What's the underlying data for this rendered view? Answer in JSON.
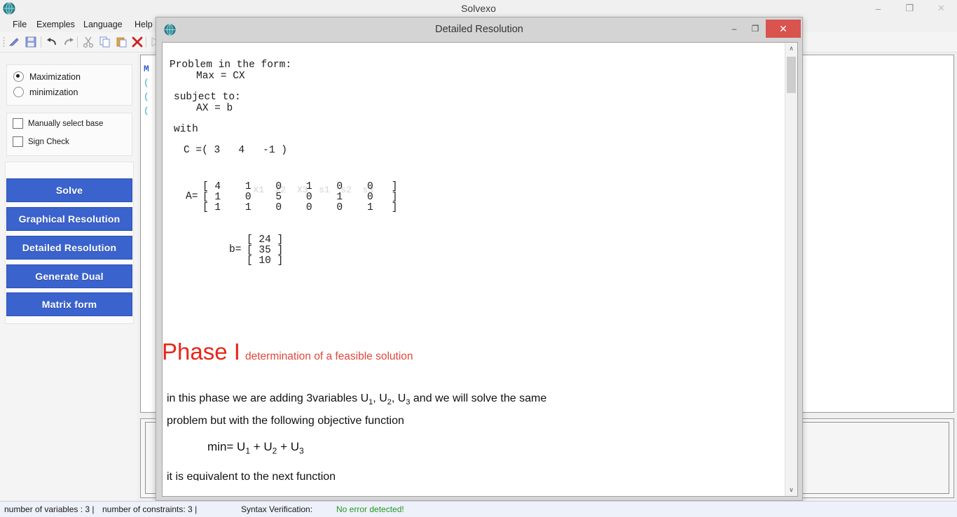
{
  "main_window": {
    "title": "Solvexo",
    "app_icon": "app-globe-icon",
    "minimize": "–",
    "maximize": "❐",
    "close": "✕"
  },
  "menubar": {
    "items": [
      {
        "label": "File"
      },
      {
        "label": "Exemples"
      },
      {
        "label": "Language"
      },
      {
        "label": "Help"
      }
    ]
  },
  "toolbar": {
    "icons": [
      {
        "name": "new-icon",
        "glyph": "✐"
      },
      {
        "name": "save-icon",
        "glyph": "ὋE"
      },
      {
        "name": "undo-icon",
        "glyph": "↶"
      },
      {
        "name": "redo-icon",
        "glyph": "↷"
      },
      {
        "name": "cut-icon",
        "glyph": "✂"
      },
      {
        "name": "copy-icon",
        "glyph": "⧉"
      },
      {
        "name": "paste-icon",
        "glyph": "ὌB"
      },
      {
        "name": "delete-icon",
        "glyph": "✖"
      },
      {
        "name": "run-icon",
        "glyph": "▷"
      }
    ]
  },
  "sidebar": {
    "objective": {
      "maximization_label": "Maximization",
      "minimization_label": "minimization",
      "selected": "Maximization"
    },
    "options": {
      "manual_base_label": "Manually select base",
      "sign_check_label": "Sign Check",
      "manual_base_checked": false,
      "sign_check_checked": false
    },
    "buttons": [
      {
        "label": "Solve"
      },
      {
        "label": "Graphical Resolution"
      },
      {
        "label": "Detailed Resolution"
      },
      {
        "label": "Generate Dual"
      },
      {
        "label": "Matrix form"
      }
    ],
    "button_color": "#3b63ce"
  },
  "dialog": {
    "title": "Detailed Resolution",
    "icon": "app-globe-icon",
    "minimize": "–",
    "maximize": "❐",
    "close": "✕",
    "close_color": "#d9534f",
    "content": {
      "problem_header": "Problem in the form:",
      "problem_objective": "Max = CX",
      "subject_to_label": "subject to:",
      "subject_to_eq": "AX = b",
      "with_label": "with",
      "c_vector": "C =( 3   4   -1 )",
      "matrix_a_label": "A=",
      "matrix_a_columns": [
        "X1",
        "X2",
        "X3",
        "s1",
        "s2",
        "s3"
      ],
      "matrix_a_rows": [
        "[ 4    1    0    1    0    0   ]",
        "[ 1    0    5    0    1    0   ]",
        "[ 1    1    0    0    0    1   ]"
      ],
      "b_label": "b=",
      "b_rows": [
        "[ 24 ]",
        "[ 35 ]",
        "[ 10 ]"
      ],
      "phase_title": "Phase I",
      "phase_subtitle": "determination of a feasible solution",
      "phase_color": "#e8261a",
      "paragraph_1_a": "in this phase we are adding 3variables  U",
      "paragraph_1_sub1": "1",
      "paragraph_1_b": ", U",
      "paragraph_1_sub2": "2",
      "paragraph_1_c": ", U",
      "paragraph_1_sub3": "3",
      "paragraph_1_d": " and we will solve the same",
      "paragraph_2": "problem but with the following objective function",
      "equation_min_a": "min= U",
      "equation_min_sub1": "1",
      "equation_min_b": " + U",
      "equation_min_sub2": "2",
      "equation_min_c": " + U",
      "equation_min_sub3": "3",
      "paragraph_3": "it is equivalent to the next function"
    },
    "scrollbar": {
      "up_arrow": "∧",
      "down_arrow": "∨"
    }
  },
  "editor_background": {
    "lines": [
      "M",
      "(",
      "(",
      "("
    ]
  },
  "statusbar": {
    "variables": "number of variables : 3  |",
    "constraints": "number of constraints: 3  |",
    "syntax_label": "Syntax Verification:",
    "syntax_value": "No error detected!",
    "syntax_color": "#1f9b22"
  }
}
